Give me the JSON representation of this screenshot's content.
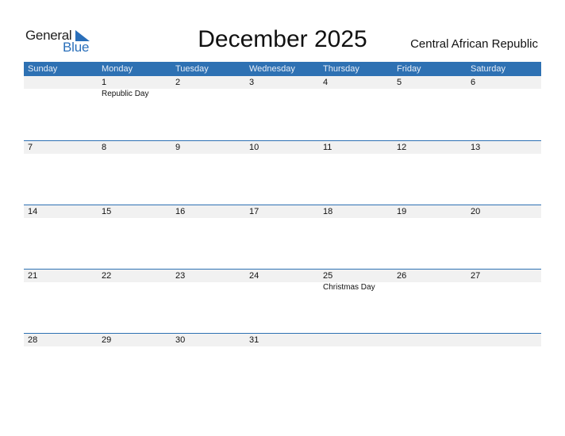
{
  "logo": {
    "part1": "General",
    "part2": "Blue",
    "accent_color": "#2a6fba"
  },
  "title": "December 2025",
  "country": "Central African Republic",
  "colors": {
    "header_bg": "#2e71b3",
    "date_strip_bg": "#f1f1f1"
  },
  "weekdays": [
    "Sunday",
    "Monday",
    "Tuesday",
    "Wednesday",
    "Thursday",
    "Friday",
    "Saturday"
  ],
  "weeks": [
    [
      {
        "day": ""
      },
      {
        "day": "1",
        "holiday": "Republic Day"
      },
      {
        "day": "2"
      },
      {
        "day": "3"
      },
      {
        "day": "4"
      },
      {
        "day": "5"
      },
      {
        "day": "6"
      }
    ],
    [
      {
        "day": "7"
      },
      {
        "day": "8"
      },
      {
        "day": "9"
      },
      {
        "day": "10"
      },
      {
        "day": "11"
      },
      {
        "day": "12"
      },
      {
        "day": "13"
      }
    ],
    [
      {
        "day": "14"
      },
      {
        "day": "15"
      },
      {
        "day": "16"
      },
      {
        "day": "17"
      },
      {
        "day": "18"
      },
      {
        "day": "19"
      },
      {
        "day": "20"
      }
    ],
    [
      {
        "day": "21"
      },
      {
        "day": "22"
      },
      {
        "day": "23"
      },
      {
        "day": "24"
      },
      {
        "day": "25",
        "holiday": "Christmas Day"
      },
      {
        "day": "26"
      },
      {
        "day": "27"
      }
    ],
    [
      {
        "day": "28"
      },
      {
        "day": "29"
      },
      {
        "day": "30"
      },
      {
        "day": "31"
      },
      {
        "day": ""
      },
      {
        "day": ""
      },
      {
        "day": ""
      }
    ]
  ]
}
